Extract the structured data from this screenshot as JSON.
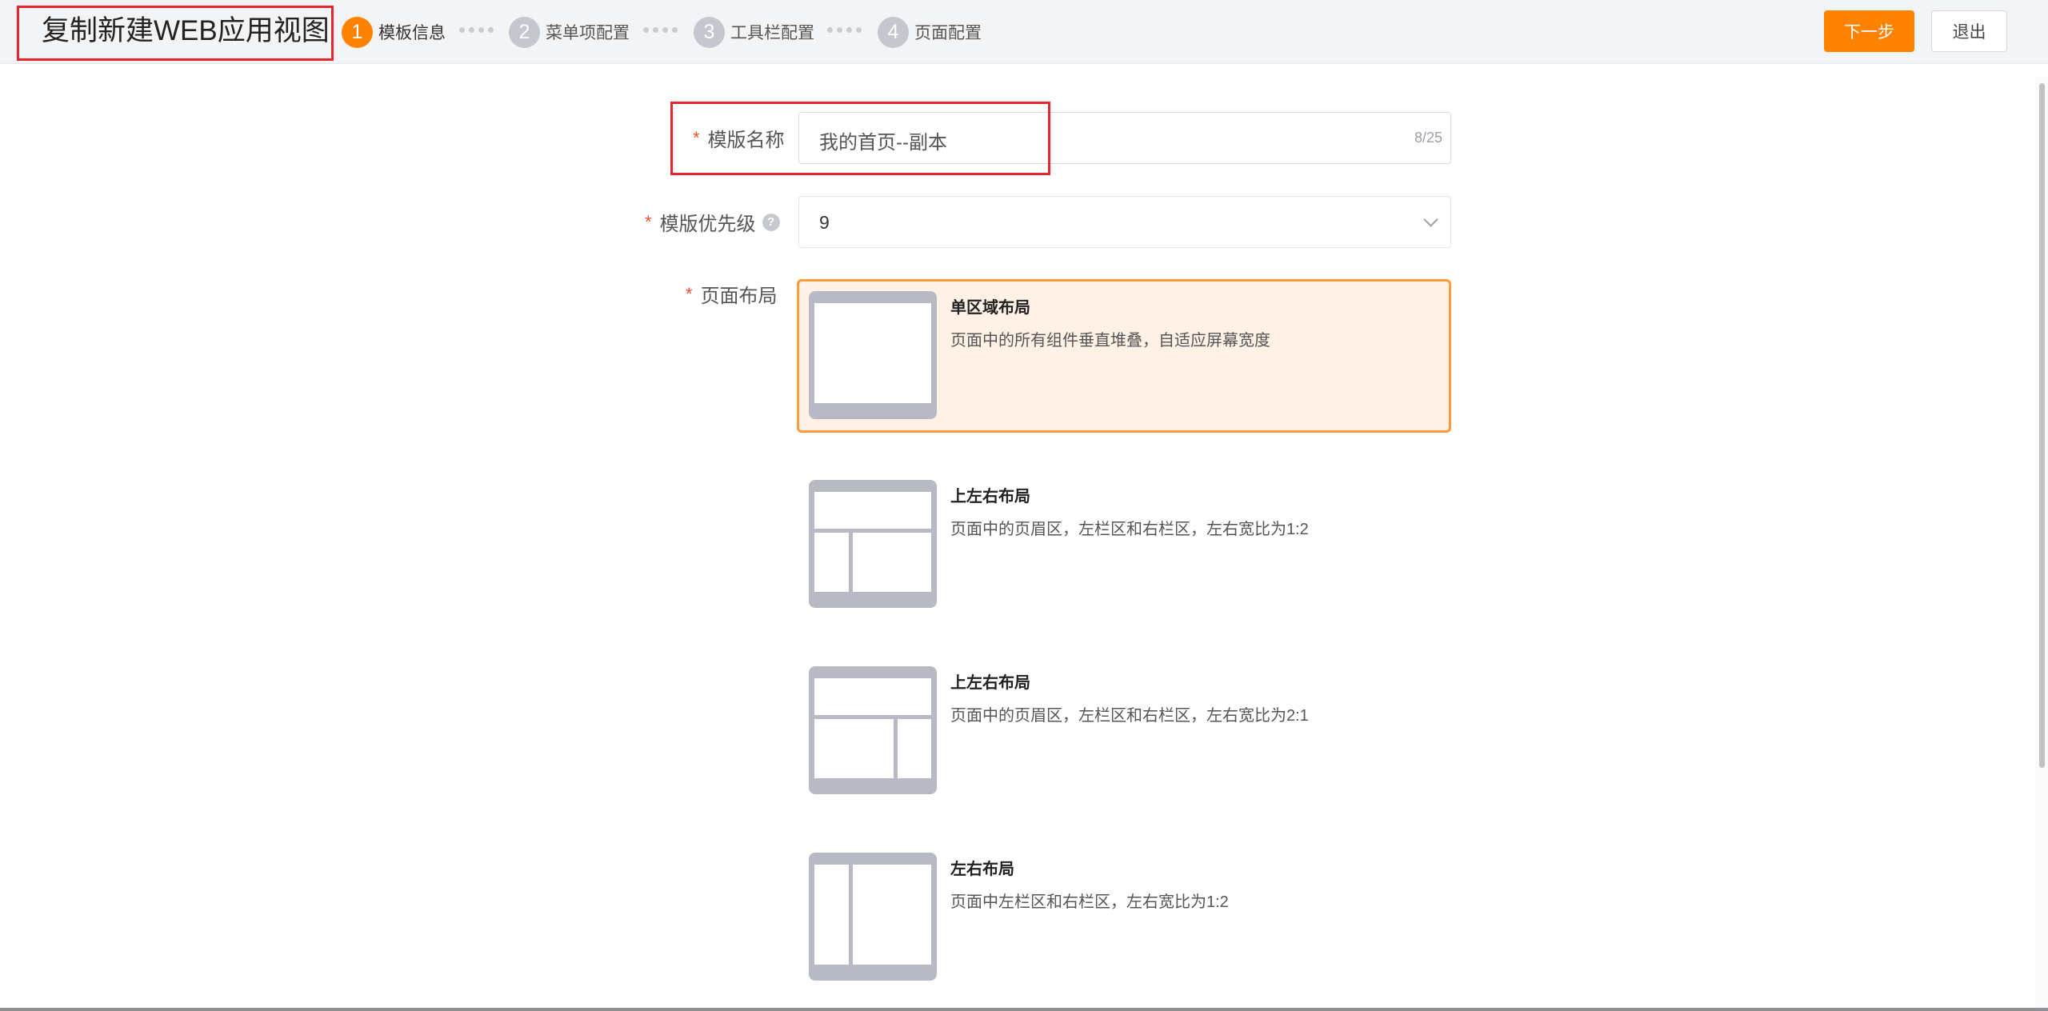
{
  "header": {
    "title": "复制新建WEB应用视图",
    "steps": [
      {
        "number": "1",
        "label": "模板信息",
        "active": true
      },
      {
        "number": "2",
        "label": "菜单项配置",
        "active": false
      },
      {
        "number": "3",
        "label": "工具栏配置",
        "active": false
      },
      {
        "number": "4",
        "label": "页面配置",
        "active": false
      }
    ],
    "next_label": "下一步",
    "exit_label": "退出"
  },
  "form": {
    "name": {
      "required_mark": "*",
      "label": "模版名称",
      "value": "我的首页--副本",
      "counter": "8/25"
    },
    "priority": {
      "required_mark": "*",
      "label": "模版优先级",
      "value": "9",
      "help_glyph": "?"
    },
    "layout": {
      "required_mark": "*",
      "label": "页面布局",
      "options": [
        {
          "title": "单区域布局",
          "desc": "页面中的所有组件垂直堆叠，自适应屏幕宽度",
          "selected": true
        },
        {
          "title": "上左右布局",
          "desc": "页面中的页眉区，左栏区和右栏区，左右宽比为1:2",
          "selected": false
        },
        {
          "title": "上左右布局",
          "desc": "页面中的页眉区，左栏区和右栏区，左右宽比为2:1",
          "selected": false
        },
        {
          "title": "左右布局",
          "desc": "页面中左栏区和右栏区，左右宽比为1:2",
          "selected": false
        }
      ]
    }
  },
  "colors": {
    "accent": "#ff8200",
    "selected_bg": "#fff1e5",
    "highlight": "#e5262c",
    "required": "#f0502c"
  },
  "icons": {
    "help": "question-circle-icon",
    "dropdown": "chevron-down-icon"
  }
}
